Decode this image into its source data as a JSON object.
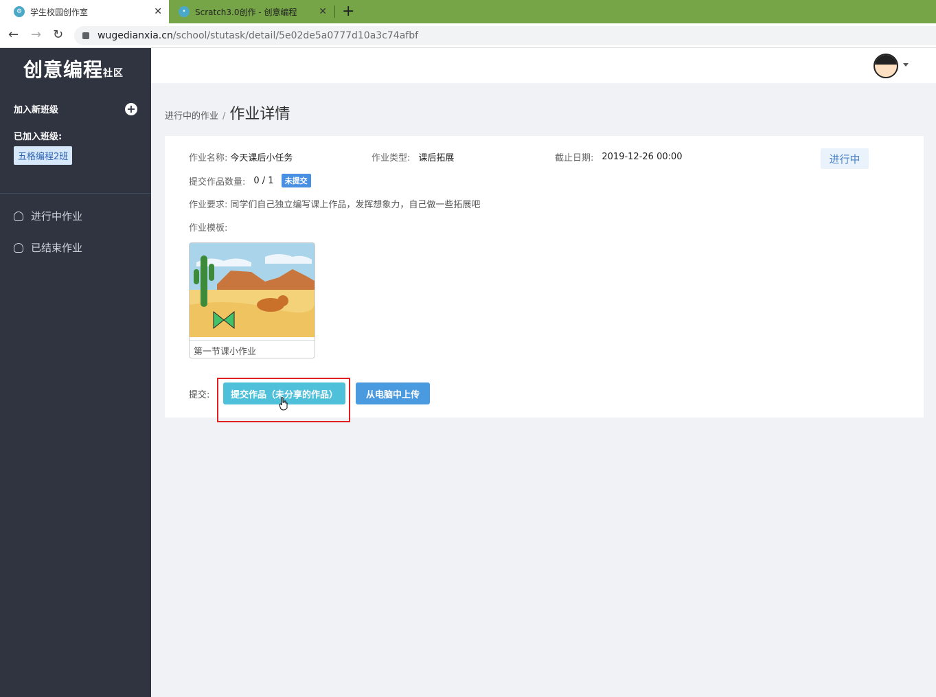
{
  "browser": {
    "tabs": [
      {
        "title": "学生校园创作室",
        "active": true
      },
      {
        "title": "Scratch3.0创作 - 创意编程",
        "active": false
      }
    ],
    "new_tab_icon": "plus-icon",
    "url_host": "wugedianxia.cn",
    "url_path": "/school/stutask/detail/5e02de5a0777d10a3c74afbf"
  },
  "sidebar": {
    "logo_main": "创意编程",
    "logo_sub": "社区",
    "join_label": "加入新班级",
    "joined_label": "已加入班级:",
    "class_name": "五格编程2班",
    "menu": [
      {
        "label": "进行中作业",
        "icon": "user-icon"
      },
      {
        "label": "已结束作业",
        "icon": "user-icon"
      }
    ]
  },
  "breadcrumb": {
    "parent": "进行中的作业",
    "separator": "/",
    "current": "作业详情"
  },
  "detail": {
    "name_label": "作业名称:",
    "name_value": "今天课后小任务",
    "type_label": "作业类型:",
    "type_value": "课后拓展",
    "deadline_label": "截止日期:",
    "deadline_value": "2019-12-26 00:00",
    "status": "进行中",
    "count_label": "提交作品数量:",
    "count_value": "0 / 1",
    "count_badge": "未提交",
    "req_label": "作业要求:",
    "req_value": "同学们自己独立编写课上作品，发挥想象力，自己做一些拓展吧",
    "template_label": "作业模板:",
    "template_title": "第一节课小作业",
    "submit_label": "提交:",
    "submit_button": "提交作品（未分享的作品）",
    "upload_button": "从电脑中上传"
  },
  "colors": {
    "tabbar": "#76a547",
    "sidebar": "#2f3440",
    "submit_btn": "#4fc0d9",
    "upload_btn": "#4a9ae0",
    "highlight": "#e02020"
  }
}
